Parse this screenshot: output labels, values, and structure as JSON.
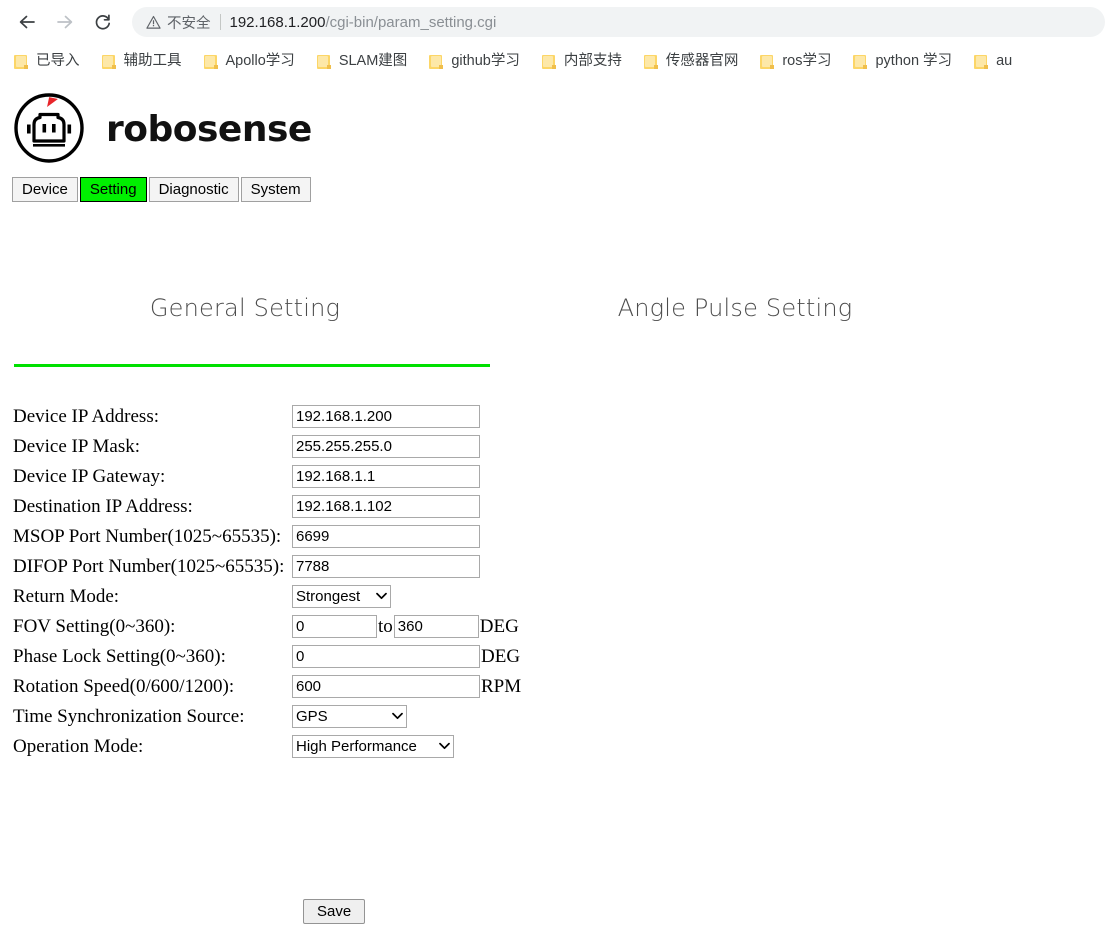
{
  "browser": {
    "back_icon": "back-arrow-icon",
    "forward_icon": "forward-arrow-icon",
    "reload_icon": "reload-icon",
    "security": {
      "icon": "warning-triangle-icon",
      "label": "不安全"
    },
    "url_host": "192.168.1.200",
    "url_path": "/cgi-bin/param_setting.cgi",
    "bookmarks": [
      {
        "label": "已导入"
      },
      {
        "label": "辅助工具"
      },
      {
        "label": "Apollo学习"
      },
      {
        "label": "SLAM建图"
      },
      {
        "label": "github学习"
      },
      {
        "label": "内部支持"
      },
      {
        "label": "传感器官网"
      },
      {
        "label": "ros学习"
      },
      {
        "label": "python 学习"
      },
      {
        "label": "au"
      }
    ]
  },
  "brand": {
    "logo_icon": "robosense-robot-logo-icon",
    "wordmark": "robosense",
    "accent_color": "#e8252a"
  },
  "nav_tabs": [
    {
      "label": "Device",
      "active": false
    },
    {
      "label": "Setting",
      "active": true
    },
    {
      "label": "Diagnostic",
      "active": false
    },
    {
      "label": "System",
      "active": false
    }
  ],
  "section_tabs": [
    {
      "label": "General Setting",
      "active": true
    },
    {
      "label": "Angle Pulse Setting",
      "active": false
    }
  ],
  "accent_green": "#00e000",
  "tab_active_green": "#00f000",
  "form": {
    "device_ip": {
      "label": "Device IP Address:",
      "value": "192.168.1.200"
    },
    "device_mask": {
      "label": "Device IP Mask:",
      "value": "255.255.255.0"
    },
    "device_gateway": {
      "label": "Device IP Gateway:",
      "value": "192.168.1.1"
    },
    "dest_ip": {
      "label": "Destination IP Address:",
      "value": "192.168.1.102"
    },
    "msop_port": {
      "label": "MSOP Port Number(1025~65535):",
      "value": "6699"
    },
    "difop_port": {
      "label": "DIFOP Port Number(1025~65535):",
      "value": "7788"
    },
    "return_mode": {
      "label": "Return Mode:",
      "value": "Strongest"
    },
    "fov": {
      "label": "FOV Setting(0~360):",
      "start": "0",
      "to": "to",
      "end": "360",
      "unit": "DEG"
    },
    "phase_lock": {
      "label": "Phase Lock Setting(0~360):",
      "value": "0",
      "unit": "DEG"
    },
    "rotation_speed": {
      "label": "Rotation Speed(0/600/1200):",
      "value": "600",
      "unit": "RPM"
    },
    "time_sync": {
      "label": "Time Synchronization Source:",
      "value": "GPS"
    },
    "operation_mode": {
      "label": "Operation Mode:",
      "value": "High Performance"
    },
    "save_label": "Save"
  }
}
